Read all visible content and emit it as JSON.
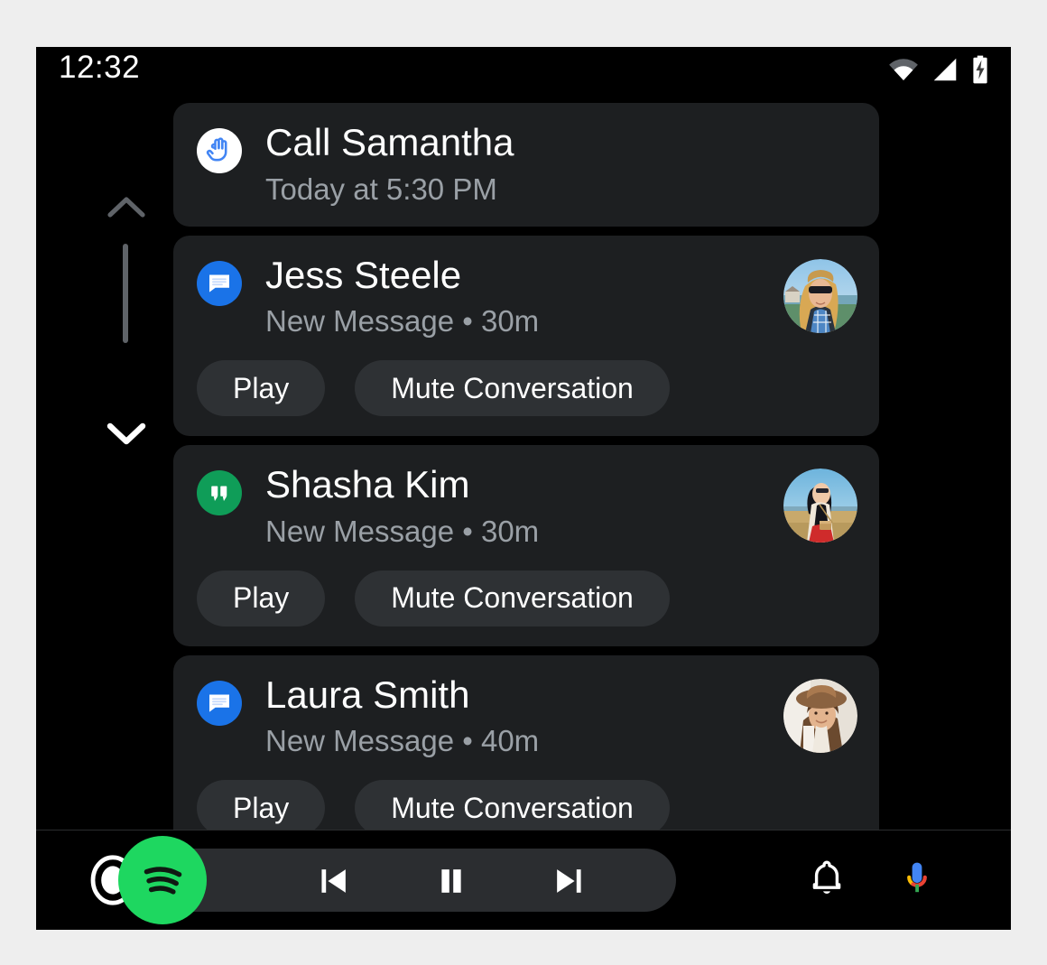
{
  "status_bar": {
    "clock": "12:32",
    "icons": [
      {
        "name": "wifi-icon",
        "label": "Wi-Fi"
      },
      {
        "name": "cellular-signal-icon",
        "label": "Cellular"
      },
      {
        "name": "battery-charging-icon",
        "label": "Battery charging"
      }
    ]
  },
  "scroll": {
    "up_label": "Scroll up",
    "down_label": "Scroll down",
    "thumb_label": "Scroll position"
  },
  "notifications": [
    {
      "id": "call-samantha",
      "title": "Call Samantha",
      "subtitle": "Today at 5:30 PM",
      "app_icon": "reminder-hand-string-icon",
      "app_icon_bg": "#ffffff",
      "has_avatar": false,
      "actions": []
    },
    {
      "id": "jess-steele",
      "title": "Jess Steele",
      "subtitle": "New Message • 30m",
      "app_icon": "google-messages-icon",
      "app_icon_bg": "#1a73e8",
      "has_avatar": true,
      "avatar_alt": "Blonde woman with sunglasses in blue plaid shirt",
      "actions": [
        "Play",
        "Mute Conversation"
      ]
    },
    {
      "id": "shasha-kim",
      "title": "Shasha Kim",
      "subtitle": "New Message • 30m",
      "app_icon": "google-hangouts-icon",
      "app_icon_bg": "#0f9d58",
      "has_avatar": true,
      "avatar_alt": "Woman with long dark hair and red skirt in a field",
      "actions": [
        "Play",
        "Mute Conversation"
      ]
    },
    {
      "id": "laura-smith",
      "title": "Laura Smith",
      "subtitle": "New Message • 40m",
      "app_icon": "google-messages-icon",
      "app_icon_bg": "#1a73e8",
      "has_avatar": true,
      "avatar_alt": "Smiling woman wearing a brown wide-brim hat",
      "actions": [
        "Play",
        "Mute Conversation"
      ]
    }
  ],
  "bottom_bar": {
    "home_label": "Home",
    "media": {
      "app_icon": "spotify-icon",
      "app_color": "#1ed760",
      "previous_label": "Previous track",
      "pause_label": "Pause",
      "next_label": "Next track"
    },
    "notifications_label": "Notifications",
    "assistant_label": "Google Assistant"
  },
  "colors": {
    "screen_bg": "#000000",
    "card_bg": "#1d1f21",
    "button_bg": "#2e3134",
    "text_primary": "#ffffff",
    "text_secondary": "#9aa0a6",
    "page_bg": "#eeeeee"
  }
}
